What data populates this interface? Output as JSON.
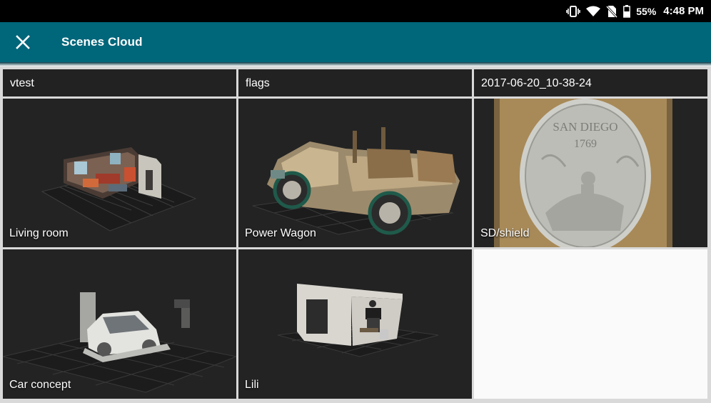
{
  "status_bar": {
    "battery_percent": "55%",
    "time": "4:48 PM",
    "icons": [
      "vibrate-icon",
      "wifi-icon",
      "no-sim-icon",
      "battery-icon"
    ]
  },
  "app_bar": {
    "close_icon": "close-icon",
    "title": "Scenes Cloud",
    "background_color": "#00667a"
  },
  "folders": [
    {
      "label": "vtest"
    },
    {
      "label": "flags"
    },
    {
      "label": "2017-06-20_10-38-24"
    }
  ],
  "scenes": [
    {
      "label": "Living room"
    },
    {
      "label": "Power Wagon"
    },
    {
      "label": "SD/shield"
    },
    {
      "label": "Car concept"
    },
    {
      "label": "Lili"
    }
  ],
  "shield_text": {
    "line1": "SAN DIEGO",
    "line2": "1769"
  }
}
